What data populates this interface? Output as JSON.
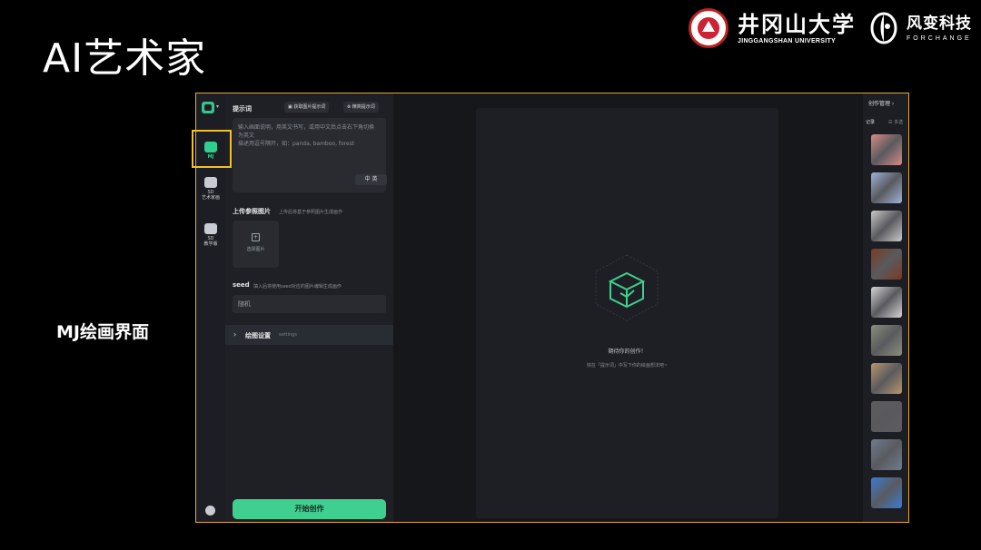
{
  "slide": {
    "title": "AI艺术家",
    "caption": "MJ绘画界面"
  },
  "brand": {
    "university_cn": "井冈山大学",
    "university_en": "JINGGANGSHAN UNIVERSITY",
    "company_cn": "风变科技",
    "company_en": "FORCHANGE"
  },
  "app": {
    "accent_color": "#3fcf8e",
    "rail": {
      "items": [
        {
          "label": "MJ",
          "icon": "image-icon",
          "active": true
        },
        {
          "label": "SD",
          "sublabel": "艺术家画",
          "icon": "chat-icon"
        },
        {
          "label": "SD",
          "sublabel": "教学版",
          "icon": "chat-icon"
        }
      ]
    },
    "form": {
      "prompt_label": "提示词",
      "btn_image_prompt": "获取图片提示词",
      "btn_refine_prompt": "精简提示词",
      "prompt_placeholder": "输入画面说明，用英文书写，或用中文后点击右下角切换为英文\n描述用逗号隔开，如：panda, bamboo, forest",
      "lang_toggle": "中  英",
      "upload_label": "上传参照图片",
      "upload_hint": "上传后将基于参照图片生成画作",
      "upload_button": "选择图片",
      "seed_label": "seed",
      "seed_hint": "填入后将使用seed对应的图片编辑生成画作",
      "seed_value": "随机",
      "settings_label": "绘图设置",
      "settings_sub": "settings",
      "start_button": "开始创作"
    },
    "canvas": {
      "empty_title": "期待你的创作！",
      "empty_sub": "快在「提示词」中写下你的绘画想法吧~"
    },
    "history": {
      "header": "创作管理 ›",
      "records_label": "记录",
      "multi_label": "☰ 多选",
      "thumbnails": [
        {
          "color": "#d88a86"
        },
        {
          "color": "#9eb3d9"
        },
        {
          "color": "#c9c9c9"
        },
        {
          "color": "#7a3a22"
        },
        {
          "color": "#d5d5d5"
        },
        {
          "color": "#8a8f78"
        },
        {
          "color": "#b89668"
        },
        {
          "color": "#5c5c5c"
        },
        {
          "color": "#6f7c8f"
        },
        {
          "color": "#3a7bd5"
        }
      ]
    }
  }
}
